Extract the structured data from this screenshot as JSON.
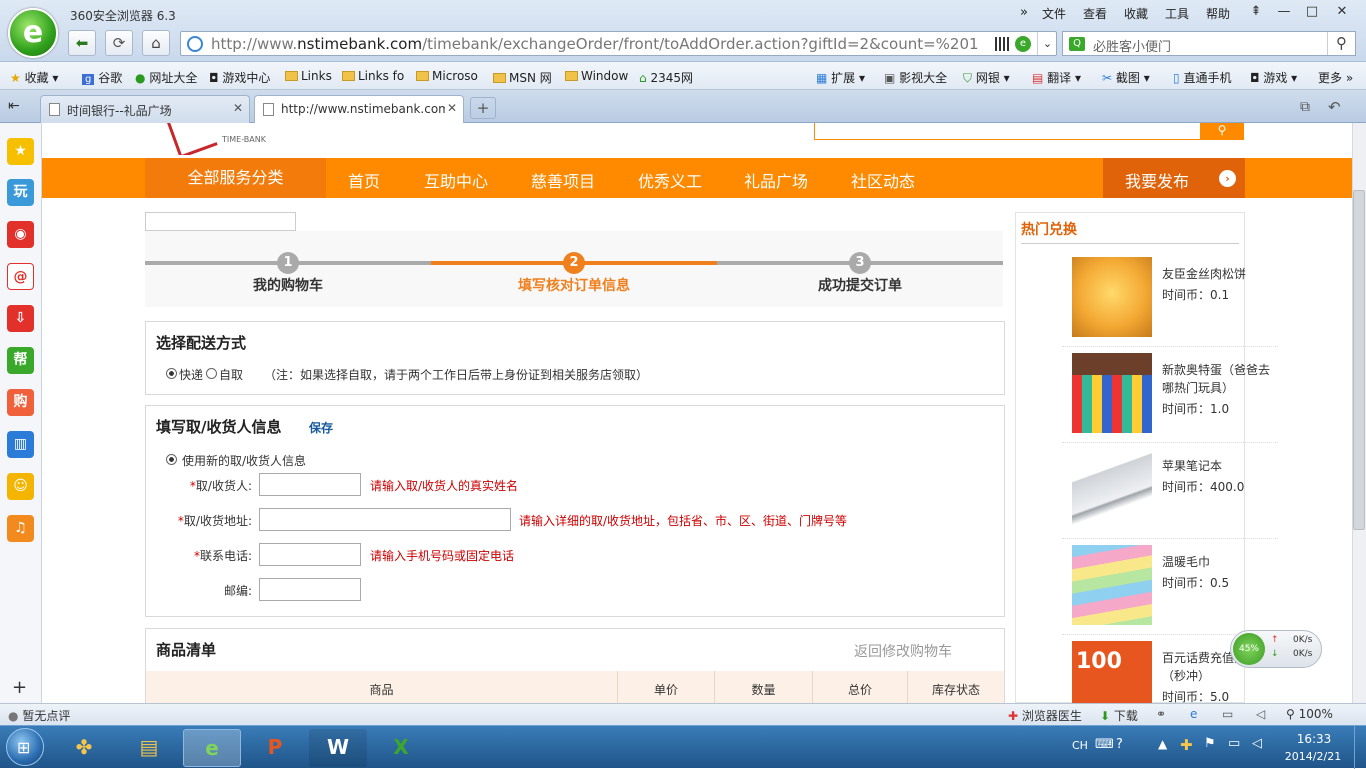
{
  "browser": {
    "app_title": "360安全浏览器 6.3",
    "menu": [
      "文件",
      "查看",
      "收藏",
      "工具",
      "帮助"
    ],
    "url_host": "http://www.nstimebank.com",
    "url_host_bold": "nstimebank.com",
    "url_prefix": "http://www.",
    "url_path": "/timebank/exchangeOrder/front/toAddOrder.action?giftId=2&count=%201",
    "search_placeholder": "必胜客小便门",
    "bookmarks": [
      "收藏",
      "谷歌",
      "网址大全",
      "游戏中心",
      "Links",
      "Links fo",
      "Microso",
      "MSN 网",
      "Window",
      "2345网"
    ],
    "toolbar_right": [
      "扩展",
      "影视大全",
      "网银",
      "翻译",
      "截图",
      "直通手机",
      "游戏",
      "更多"
    ],
    "tabs": [
      {
        "label": "时间银行--礼品广场"
      },
      {
        "label": "http://www.nstimebank.com"
      }
    ]
  },
  "site": {
    "nav": {
      "all_categories": "全部服务分类",
      "items": [
        "首页",
        "互助中心",
        "慈善项目",
        "优秀义工",
        "礼品广场",
        "社区动态"
      ],
      "publish": "我要发布"
    },
    "steps": [
      {
        "num": "1",
        "label": "我的购物车"
      },
      {
        "num": "2",
        "label": "填写核对订单信息"
      },
      {
        "num": "3",
        "label": "成功提交订单"
      }
    ],
    "delivery": {
      "title": "选择配送方式",
      "option_express": "快递",
      "option_pickup": "自取",
      "note": "（注：如果选择自取，请于两个工作日后带上身份证到相关服务店领取）"
    },
    "receiver": {
      "title": "填写取/收货人信息",
      "save": "保存",
      "use_new": "使用新的取/收货人信息",
      "fields": [
        {
          "label": "取/收货人:",
          "required": "*",
          "hint": "请输入取/收货人的真实姓名"
        },
        {
          "label": "取/收货地址:",
          "required": "*",
          "hint": "请输入详细的取/收货地址，包括省、市、区、街道、门牌号等"
        },
        {
          "label": "联系电话:",
          "required": "*",
          "hint": "请输入手机号码或固定电话"
        },
        {
          "label": "邮编:",
          "required": "",
          "hint": ""
        }
      ]
    },
    "goods": {
      "title": "商品清单",
      "back_link": "返回修改购物车",
      "columns": [
        "商品",
        "单价",
        "数量",
        "总价",
        "库存状态"
      ]
    },
    "hot": {
      "title": "热门兑换",
      "price_label": "时间币：",
      "items": [
        {
          "name": "友臣金丝肉松饼",
          "price": "0.1"
        },
        {
          "name": "新款奥特蛋（爸爸去哪热门玩具）",
          "price": "1.0"
        },
        {
          "name": "苹果笔记本",
          "price": "400.0"
        },
        {
          "name": "温暖毛巾",
          "price": "0.5"
        },
        {
          "name": "百元话费充值兑换（秒冲）",
          "price": "5.0"
        }
      ]
    },
    "speed_widget": {
      "percent": "45%",
      "up": "0K/s",
      "down": "0K/s"
    }
  },
  "statusbar": {
    "left": "暂无点评",
    "items": [
      "浏览器医生",
      "下载"
    ],
    "zoom": "100%"
  },
  "taskbar": {
    "lang": "CH",
    "time": "16:33",
    "date": "2014/2/21"
  },
  "colors": {
    "orange": "#ff8a00",
    "dark_orange": "#e0630a",
    "step_active": "#f07f1e",
    "required_red": "#cc0000",
    "link_blue": "#1a5a9a"
  }
}
